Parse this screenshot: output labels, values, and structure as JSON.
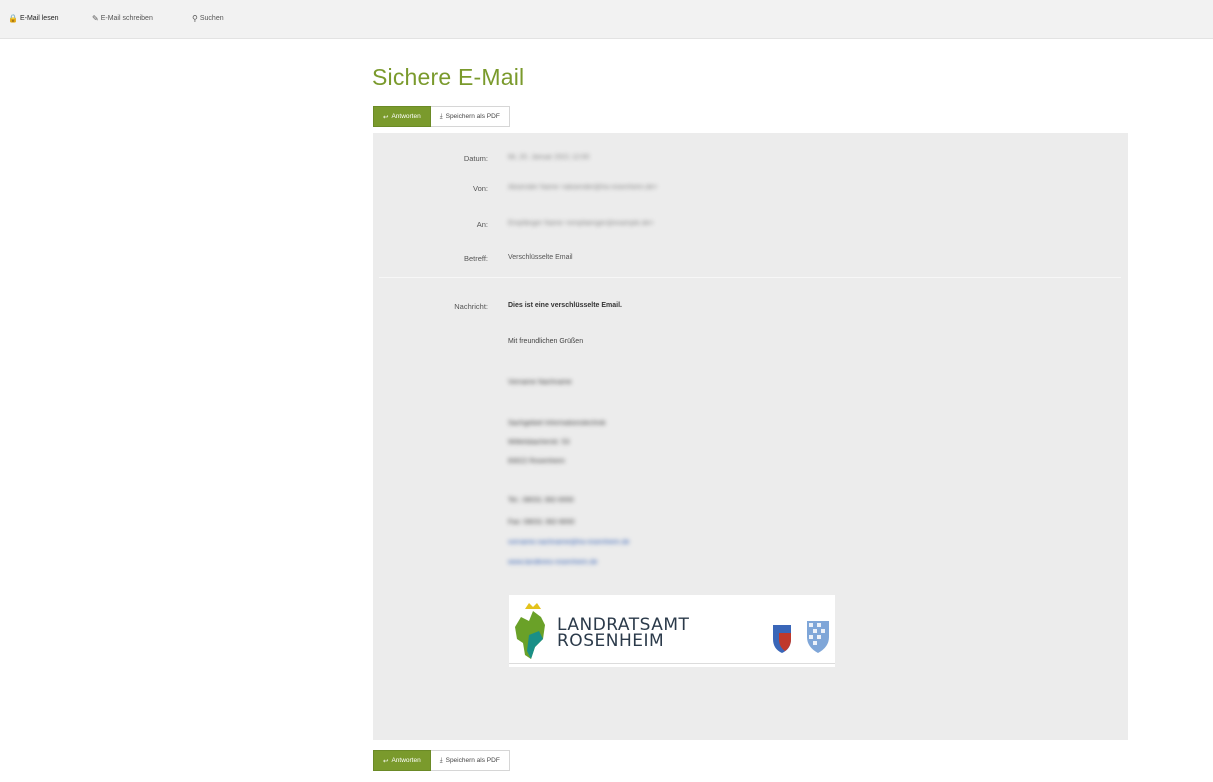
{
  "nav": {
    "items": [
      {
        "label": "E-Mail lesen",
        "icon": "lock-icon",
        "active": true
      },
      {
        "label": "E-Mail schreiben",
        "icon": "pencil-icon",
        "active": false
      },
      {
        "label": "Suchen",
        "icon": "search-icon",
        "active": false
      }
    ]
  },
  "page_title": "Sichere E-Mail",
  "actions": {
    "reply_label": "Antworten",
    "pdf_label": "Speichern als PDF"
  },
  "email": {
    "fields": [
      {
        "label": "Datum:",
        "value": "Mi, 20. Januar 2021 12:00",
        "blurred": true
      },
      {
        "label": "Von:",
        "value": "Absender Name <absender@lra-rosenheim.de>",
        "blurred": true
      },
      {
        "label": "An:",
        "value": "Empfänger Name <empfaenger@example.de>",
        "blurred": true
      },
      {
        "label": "Betreff:",
        "value": "Verschlüsselte Email",
        "blurred": false
      }
    ],
    "message_label": "Nachricht:",
    "message": {
      "line1": "Dies ist eine verschlüsselte Email.",
      "greeting": "Mit freundlichen Grüßen",
      "name": "Vorname Nachname",
      "dept1": "Sachgebiet Informationstechnik",
      "dept2": "Wittelsbacherstr. 53",
      "dept3": "83022 Rosenheim",
      "tel": "Tel.: 08031 392-0000",
      "fax": "Fax: 08031 392-9000",
      "email": "vorname.nachname@lra-rosenheim.de",
      "web": "www.landkreis-rosenheim.de"
    }
  },
  "logo": {
    "text_line1": "LANDRATSAMT",
    "text_line2": "ROSENHEIM",
    "brand_green": "#6aa128",
    "brand_teal": "#1a8f87"
  },
  "colors": {
    "accent": "#7a9a2c",
    "panel": "#ececec"
  }
}
